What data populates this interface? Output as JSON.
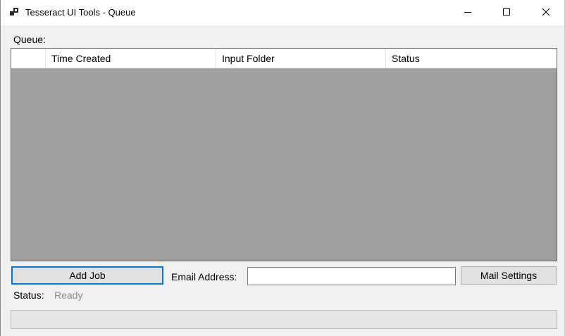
{
  "window": {
    "title": "Tesseract UI Tools - Queue",
    "app_icon": "app-window-icon",
    "controls": {
      "minimize_icon": "minimize-icon",
      "maximize_icon": "maximize-icon",
      "close_icon": "close-icon"
    }
  },
  "queue": {
    "label": "Queue:",
    "columns": [
      "",
      "Time Created",
      "Input Folder",
      "Status"
    ],
    "rows": []
  },
  "actions": {
    "add_job_label": "Add Job",
    "email_label": "Email Address:",
    "email_value": "",
    "mail_settings_label": "Mail Settings"
  },
  "status": {
    "label": "Status:",
    "value": "Ready"
  },
  "progress": {
    "percent": 0
  },
  "colors": {
    "grid_background": "#a0a0a0",
    "focus_accent": "#0078d7",
    "status_text": "#8c8c8c"
  }
}
